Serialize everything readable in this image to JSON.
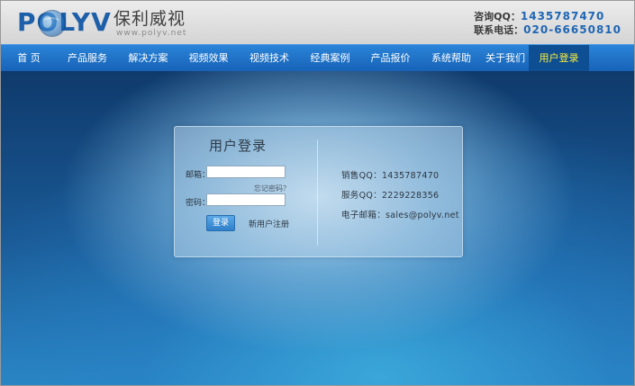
{
  "header": {
    "logo_word": "POLYV",
    "logo_cn": "保利威视",
    "logo_url": "www.polyv.net",
    "contact_qq_label": "咨询QQ：",
    "contact_qq_value": "1435787470",
    "contact_phone_label": "联系电话：",
    "contact_phone_value": "020-66650810"
  },
  "nav": {
    "items": [
      {
        "label": "首 页"
      },
      {
        "label": "产品服务"
      },
      {
        "label": "解决方案"
      },
      {
        "label": "视频效果"
      },
      {
        "label": "视频技术"
      },
      {
        "label": "经典案例"
      },
      {
        "label": "产品报价"
      },
      {
        "label": "系统帮助"
      },
      {
        "label": "关于我们"
      },
      {
        "label": "用户登录"
      }
    ],
    "active_index": 9,
    "active_color": "#ffef3a"
  },
  "login": {
    "title": "用户登录",
    "email_label": "邮箱：",
    "email_value": "",
    "forgot_label": "忘记密码？",
    "password_label": "密码：",
    "password_value": "",
    "submit_label": "登录",
    "register_label": "新用户注册"
  },
  "info": {
    "sales_qq": "销售QQ：1435787470",
    "service_qq": "服务QQ：2229228356",
    "email": "电子邮箱：sales@polyv.net"
  }
}
